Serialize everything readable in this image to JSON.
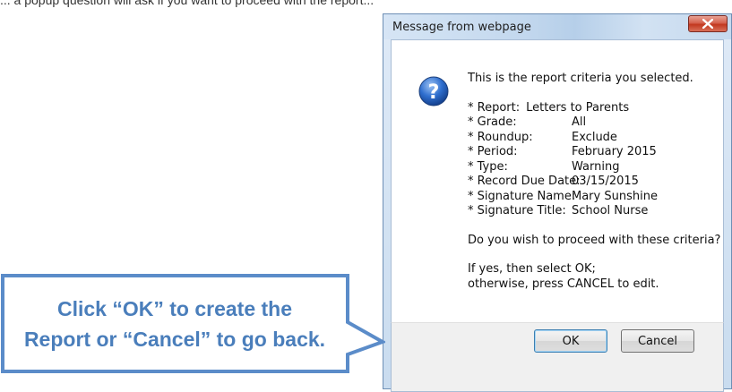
{
  "top_text": "... a popup question will ask if you want to proceed with the report...",
  "dialog": {
    "title": "Message from webpage",
    "close_icon": "close-icon",
    "question_icon": "question-icon",
    "intro": "This is the report criteria you selected.",
    "report_label": "* Report:",
    "report_value": "Letters to Parents",
    "criteria": [
      {
        "label": "* Grade:",
        "value": "All"
      },
      {
        "label": "* Roundup:",
        "value": "Exclude"
      },
      {
        "label": "* Period:",
        "value": "February 2015"
      },
      {
        "label": "* Type:",
        "value": "Warning"
      },
      {
        "label": "* Record Due Date:",
        "value": "03/15/2015"
      },
      {
        "label": "* Signature Name:",
        "value": "Mary Sunshine"
      },
      {
        "label": "* Signature Title:",
        "value": "School Nurse"
      }
    ],
    "question": "Do you wish to proceed with these criteria?",
    "instruction_1": "If yes, then select OK;",
    "instruction_2": "otherwise, press CANCEL to edit.",
    "ok_label": "OK",
    "cancel_label": "Cancel"
  },
  "callout": {
    "line1": "Click “OK” to create the",
    "line2": "Report or “Cancel” to go back."
  },
  "colors": {
    "callout_text": "#4a7ebb",
    "callout_border": "#5b8cc9"
  }
}
